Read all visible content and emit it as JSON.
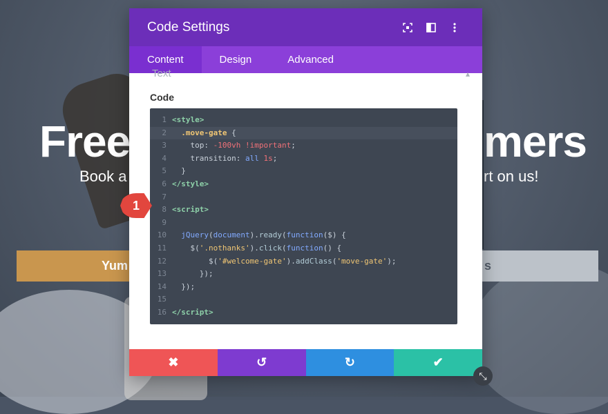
{
  "background": {
    "headline_left": "Free",
    "headline_right": "mers",
    "subline_left": "Book a",
    "subline_right": "rt on us!",
    "button_left": "Yum",
    "button_right": "s"
  },
  "modal": {
    "title": "Code Settings",
    "header_icons": [
      "focus-icon",
      "split-view-icon",
      "more-vertical-icon"
    ],
    "tabs": [
      {
        "label": "Content",
        "active": true
      },
      {
        "label": "Design",
        "active": false
      },
      {
        "label": "Advanced",
        "active": false
      }
    ],
    "peek_label": "Text",
    "code_label": "Code",
    "code_lines": [
      {
        "num": "1"
      },
      {
        "num": "2"
      },
      {
        "num": "3"
      },
      {
        "num": "4"
      },
      {
        "num": "5"
      },
      {
        "num": "6"
      },
      {
        "num": "7"
      },
      {
        "num": "8"
      },
      {
        "num": "9"
      },
      {
        "num": "10"
      },
      {
        "num": "11"
      },
      {
        "num": "12"
      },
      {
        "num": "13"
      },
      {
        "num": "14"
      },
      {
        "num": "15"
      },
      {
        "num": "16"
      }
    ],
    "callout_number": "1",
    "footer": {
      "cancel_icon": "✖",
      "undo_icon": "↺",
      "redo_icon": "↻",
      "save_icon": "✔"
    }
  },
  "colors": {
    "header": "#6c2eb9",
    "tabs": "#8b3fd9",
    "cancel": "#ef5556",
    "undo": "#7e3bd0",
    "redo": "#2e8fe0",
    "save": "#2bc1a6",
    "callout": "#e2463e"
  }
}
